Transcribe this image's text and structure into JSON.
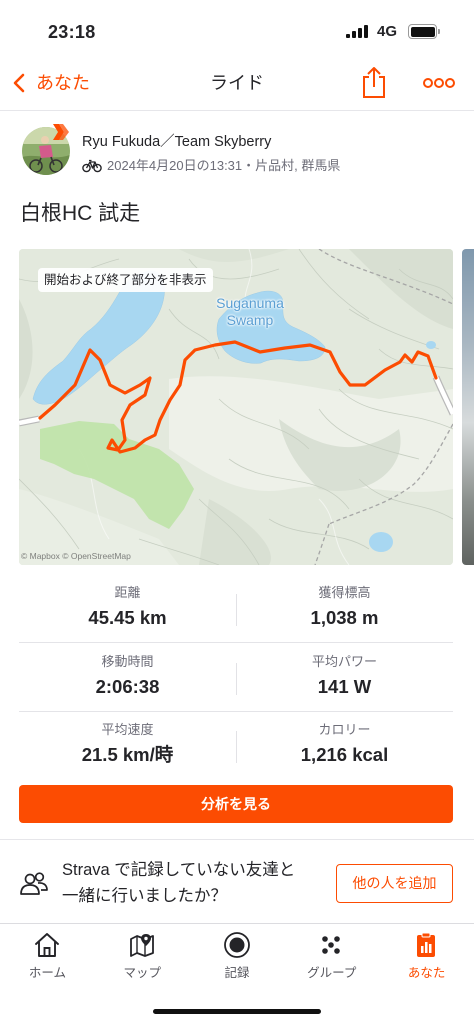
{
  "status_bar": {
    "time": "23:18",
    "network": "4G"
  },
  "nav": {
    "back_label": "あなた",
    "title": "ライド",
    "back_icon": "chevron-left-icon",
    "share_icon": "share-icon",
    "more_icon": "more-icon"
  },
  "athlete": {
    "name": "Ryu Fukuda／Team Skyberry",
    "meta": "2024年4月20日の13:31・片品村, 群馬県",
    "sport_icon": "bike-icon"
  },
  "activity": {
    "title": "白根HC 試走"
  },
  "map": {
    "toggle_label": "開始および終了部分を非表示",
    "place_label_line1": "Suganuma",
    "place_label_line2": "Swamp",
    "attribution": "© Mapbox © OpenStreetMap"
  },
  "stats": [
    {
      "label": "距離",
      "value": "45.45 km"
    },
    {
      "label": "獲得標高",
      "value": "1,038 m"
    },
    {
      "label": "移動時間",
      "value": "2:06:38"
    },
    {
      "label": "平均パワー",
      "value": "141 W"
    },
    {
      "label": "平均速度",
      "value": "21.5 km/時"
    },
    {
      "label": "カロリー",
      "value": "1,216 kcal"
    }
  ],
  "analysis_button": "分析を見る",
  "invite": {
    "text_line1": "Strava で記録していない友達と",
    "text_line2": "一緒に行いましたか？",
    "button": "他の人を追加",
    "icon": "people-icon"
  },
  "tabs": [
    {
      "label": "ホーム",
      "icon": "home-icon",
      "active": false
    },
    {
      "label": "マップ",
      "icon": "map-icon",
      "active": false
    },
    {
      "label": "記録",
      "icon": "record-icon",
      "active": false
    },
    {
      "label": "グループ",
      "icon": "group-icon",
      "active": false
    },
    {
      "label": "あなた",
      "icon": "you-icon",
      "active": true
    }
  ],
  "colors": {
    "accent": "#FC4C02",
    "text_primary": "#242428",
    "text_secondary": "#6D6D78",
    "lake": "#A8D7F1",
    "forest": "#BFE3A8"
  }
}
